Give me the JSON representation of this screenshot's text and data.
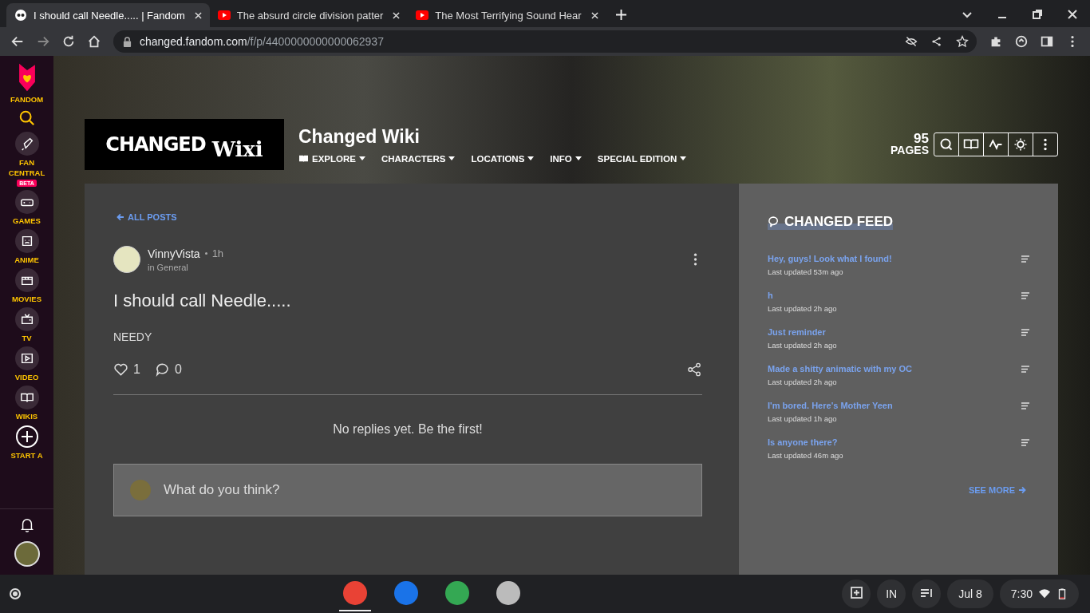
{
  "browser": {
    "tabs": [
      {
        "title": "I should call Needle..... | Fandom",
        "kind": "fandom",
        "selected": true
      },
      {
        "title": "The absurd circle division patter",
        "kind": "youtube",
        "selected": false
      },
      {
        "title": "The Most Terrifying Sound Hear",
        "kind": "youtube",
        "selected": false
      }
    ],
    "url": {
      "host": "changed.fandom.com",
      "path": "/f/p/4400000000000062937"
    }
  },
  "rail": {
    "brand": "FANDOM",
    "items": [
      {
        "label": "FAN CENTRAL",
        "badge": "BETA"
      },
      {
        "label": "GAMES"
      },
      {
        "label": "ANIME"
      },
      {
        "label": "MOVIES"
      },
      {
        "label": "TV"
      },
      {
        "label": "VIDEO"
      },
      {
        "label": "WIKIS"
      },
      {
        "label": "START A"
      }
    ]
  },
  "wiki": {
    "logo": {
      "word": "CHANGED",
      "suffix": "Wixi"
    },
    "title": "Changed Wiki",
    "pages_count": "95",
    "pages_label": "PAGES",
    "nav": [
      {
        "label": "EXPLORE",
        "icon": true
      },
      {
        "label": "CHARACTERS",
        "icon": false
      },
      {
        "label": "LOCATIONS",
        "icon": false
      },
      {
        "label": "INFO",
        "icon": false
      },
      {
        "label": "SPECIAL EDITION",
        "icon": false
      }
    ]
  },
  "post": {
    "back": "ALL POSTS",
    "author": "VinnyVista",
    "time": "1h",
    "category": "in General",
    "title": "I should call Needle.....",
    "body": "NEEDY",
    "likes": "1",
    "comments": "0",
    "empty": "No replies yet. Be the first!",
    "reply": {
      "placeholder": "What do you think?"
    }
  },
  "feed": {
    "title": "CHANGED FEED",
    "items": [
      {
        "title": "Hey, guys! Look what I found!",
        "updated": "Last updated 53m ago"
      },
      {
        "title": "h",
        "updated": "Last updated 2h ago"
      },
      {
        "title": "Just reminder",
        "updated": "Last updated 2h ago"
      },
      {
        "title": "Made a shitty animatic with my OC",
        "updated": "Last updated 2h ago"
      },
      {
        "title": "I'm bored. Here's Mother Yeen",
        "updated": "Last updated 1h ago"
      },
      {
        "title": "Is anyone there?",
        "updated": "Last updated 46m ago"
      }
    ],
    "see_more": "SEE MORE"
  },
  "shelf": {
    "apps": [
      {
        "kind": "chrome",
        "selected": true
      },
      {
        "kind": "files",
        "selected": false
      },
      {
        "kind": "play",
        "selected": false
      },
      {
        "kind": "roblox",
        "selected": false
      }
    ],
    "ime": "IN",
    "date": "Jul 8",
    "time": "7:30"
  }
}
